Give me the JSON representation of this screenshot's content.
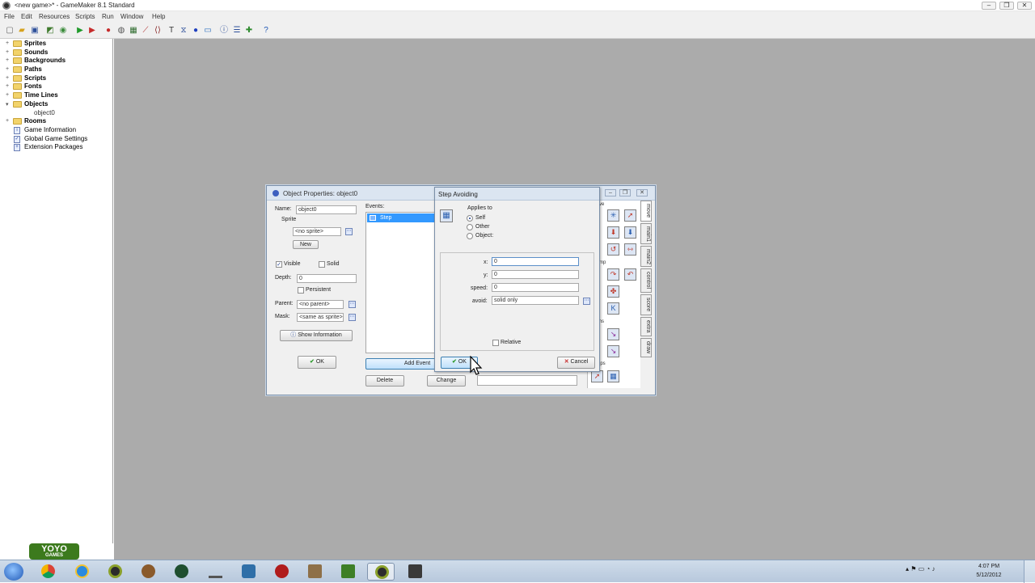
{
  "window": {
    "title": "<new game>* - GameMaker 8.1 Standard",
    "controls": {
      "minimize": "–",
      "restore": "❐",
      "close": "✕"
    }
  },
  "menu": [
    "File",
    "Edit",
    "Resources",
    "Scripts",
    "Run",
    "Window",
    "Help"
  ],
  "tree": {
    "items": [
      {
        "label": "Sprites",
        "expand": "+"
      },
      {
        "label": "Sounds",
        "expand": "+"
      },
      {
        "label": "Backgrounds",
        "expand": "+"
      },
      {
        "label": "Paths",
        "expand": "+"
      },
      {
        "label": "Scripts",
        "expand": "+"
      },
      {
        "label": "Fonts",
        "expand": "+"
      },
      {
        "label": "Time Lines",
        "expand": "+"
      },
      {
        "label": "Objects",
        "expand": "▾"
      },
      {
        "label": "object0"
      },
      {
        "label": "Rooms",
        "expand": "+"
      },
      {
        "label": "Game Information"
      },
      {
        "label": "Global Game Settings"
      },
      {
        "label": "Extension Packages"
      }
    ]
  },
  "logo": {
    "text": "YOYO",
    "subtext": "GAMES"
  },
  "object_window": {
    "title": "Object Properties: object0",
    "name_label": "Name:",
    "name_value": "object0",
    "sprite_label": "Sprite",
    "sprite_value": "<no sprite>",
    "new_button": "New",
    "visible_label": "Visible",
    "visible_checked": true,
    "solid_label": "Solid",
    "solid_checked": false,
    "depth_label": "Depth:",
    "depth_value": "0",
    "persistent_label": "Persistent",
    "parent_label": "Parent:",
    "parent_value": "<no parent>",
    "mask_label": "Mask:",
    "mask_value": "<same as sprite>",
    "show_info_button": "Show Information",
    "ok_button": "OK",
    "events_label": "Events:",
    "events": [
      "Step"
    ],
    "add_event_button": "Add Event",
    "delete_button": "Delete",
    "change_button": "Change",
    "tabs": [
      "move",
      "main1",
      "main2",
      "control",
      "score",
      "extra",
      "draw"
    ],
    "action_group_labels": [
      "ve",
      "mp",
      "ths",
      "eps"
    ]
  },
  "step_dialog": {
    "title": "Step Avoiding",
    "applies_to_label": "Applies to",
    "applies_options": [
      {
        "label": "Self",
        "selected": true
      },
      {
        "label": "Other",
        "selected": false
      },
      {
        "label": "Object:",
        "selected": false
      }
    ],
    "x_label": "x:",
    "x_value": "0",
    "y_label": "y:",
    "y_value": "0",
    "speed_label": "speed:",
    "speed_value": "0",
    "avoid_label": "avoid:",
    "avoid_value": "solid only",
    "relative_label": "Relative",
    "relative_checked": false,
    "ok_button": "OK",
    "cancel_button": "Cancel"
  },
  "taskbar": {
    "time": "4:07 PM",
    "date": "5/12/2012"
  },
  "colors": {
    "workspace": "#ababab",
    "selection": "#3399ff",
    "taskbar": "#c3d2e3"
  }
}
